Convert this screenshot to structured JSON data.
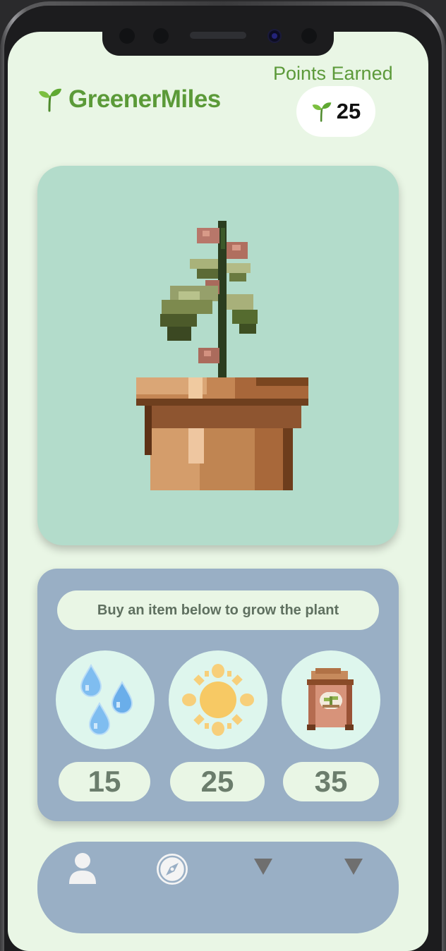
{
  "header": {
    "app_name": "GreenerMiles",
    "logo_icon": "sprout-icon",
    "points_label": "Points Earned",
    "points_icon": "sprout-icon",
    "points_value": "25"
  },
  "plant": {
    "image": "pixel-plant-in-pot"
  },
  "shop": {
    "hint": "Buy an item below to grow the plant",
    "items": [
      {
        "icon": "water-drops-icon",
        "price": "15"
      },
      {
        "icon": "sun-icon",
        "price": "25"
      },
      {
        "icon": "fertilizer-bag-icon",
        "price": "35"
      }
    ]
  },
  "nav": {
    "items": [
      {
        "icon": "profile-icon"
      },
      {
        "icon": "compass-icon"
      },
      {
        "icon": "triangle-down-icon"
      },
      {
        "icon": "triangle-down-icon"
      }
    ]
  },
  "colors": {
    "screen_bg": "#e9f6e5",
    "brand_green": "#5b9a38",
    "plant_card_bg": "#b3dccb",
    "panel_blue": "#99afc5",
    "item_circle_bg": "#def6ed"
  }
}
